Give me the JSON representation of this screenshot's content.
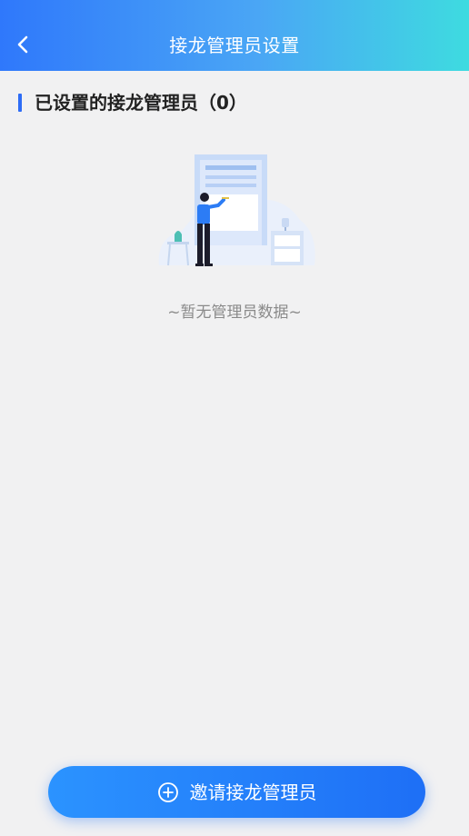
{
  "header": {
    "title": "接龙管理员设置",
    "back_icon": "chevron-left-icon"
  },
  "section": {
    "title": "已设置的接龙管理员（0）"
  },
  "empty_state": {
    "illustration": "empty-data-illustration",
    "text": "~暂无管理员数据~"
  },
  "invite_button": {
    "icon": "plus-circle-icon",
    "label": "邀请接龙管理员"
  },
  "colors": {
    "header_gradient_start": "#2f78fb",
    "header_gradient_end": "#3edbe0",
    "accent": "#2d6cf6",
    "button_gradient_start": "#2b93ff",
    "button_gradient_end": "#1e6ff6",
    "background": "#f1f1f2"
  }
}
